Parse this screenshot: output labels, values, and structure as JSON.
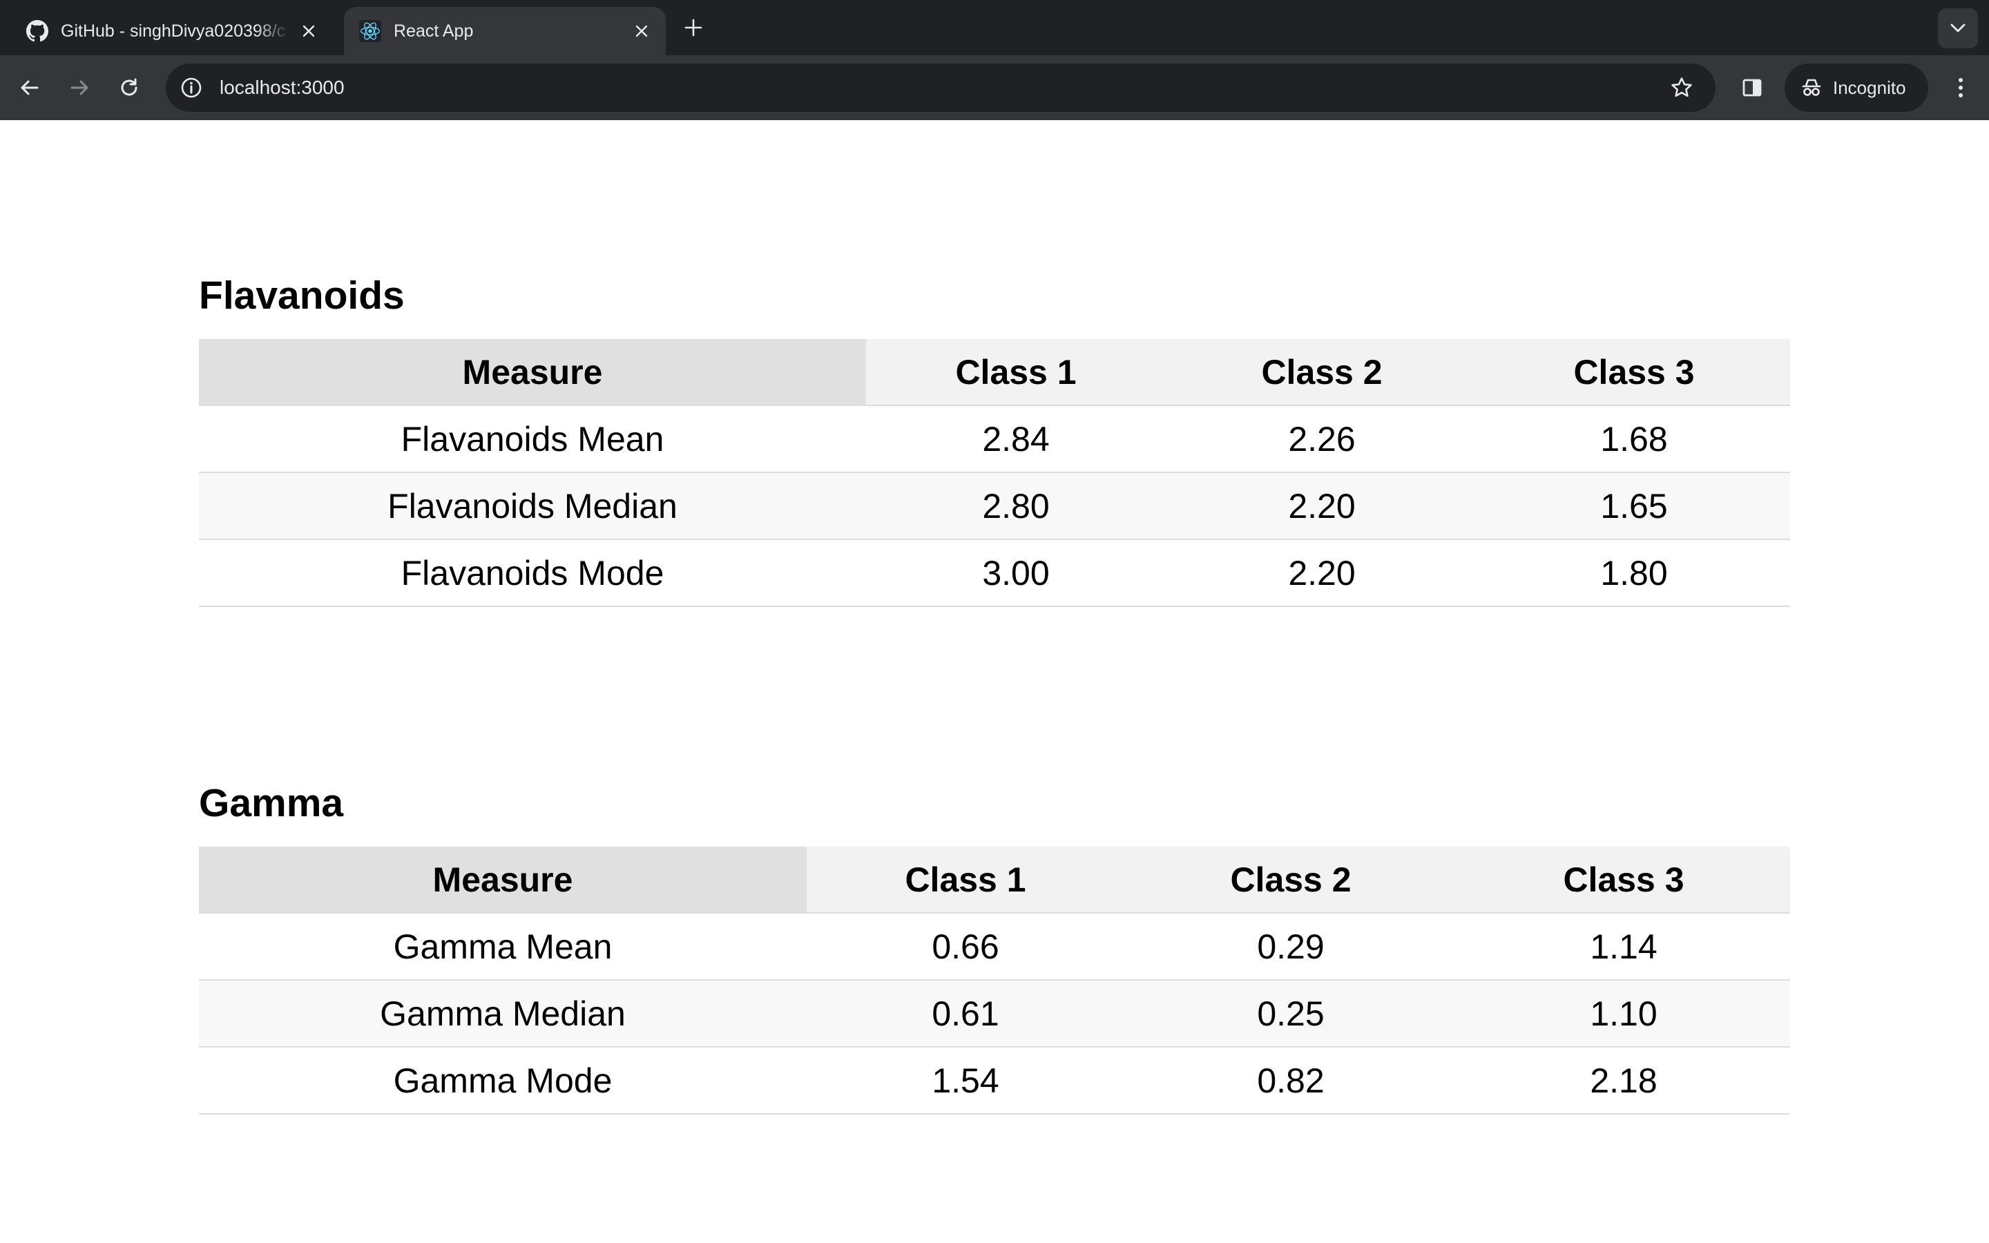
{
  "browser": {
    "tabs": [
      {
        "title": "GitHub - singhDivya020398/c",
        "favicon": "github-icon",
        "active": false
      },
      {
        "title": "React App",
        "favicon": "react-icon",
        "active": true
      }
    ],
    "url": "localhost:3000",
    "incognito_label": "Incognito"
  },
  "tables": [
    {
      "title": "Flavanoids",
      "headers": [
        "Measure",
        "Class 1",
        "Class 2",
        "Class 3"
      ],
      "rows": [
        [
          "Flavanoids Mean",
          "2.84",
          "2.26",
          "1.68"
        ],
        [
          "Flavanoids Median",
          "2.80",
          "2.20",
          "1.65"
        ],
        [
          "Flavanoids Mode",
          "3.00",
          "2.20",
          "1.80"
        ]
      ]
    },
    {
      "title": "Gamma",
      "headers": [
        "Measure",
        "Class 1",
        "Class 2",
        "Class 3"
      ],
      "rows": [
        [
          "Gamma Mean",
          "0.66",
          "0.29",
          "1.14"
        ],
        [
          "Gamma Median",
          "0.61",
          "0.25",
          "1.10"
        ],
        [
          "Gamma Mode",
          "1.54",
          "0.82",
          "2.18"
        ]
      ]
    }
  ]
}
